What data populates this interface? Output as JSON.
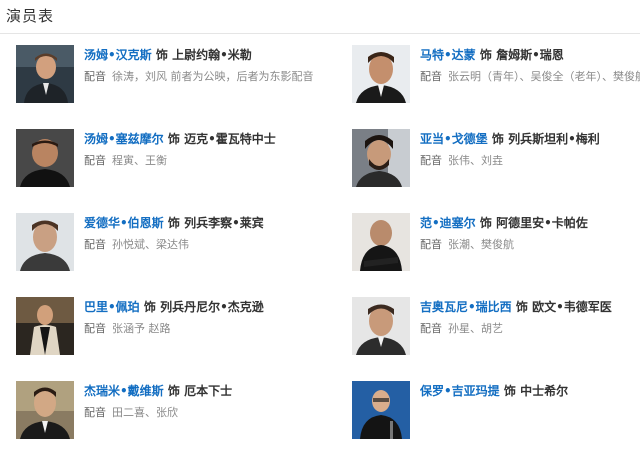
{
  "page": {
    "title": "演员表"
  },
  "cast": [
    {
      "actor": "汤姆•汉克斯",
      "connector": "饰",
      "role": "上尉约翰•米勒",
      "dub_label": "配音",
      "dubbers": "徐涛，刘风 前者为公映，后者为东影配音"
    },
    {
      "actor": "马特•达蒙",
      "connector": "饰",
      "role": "詹姆斯•瑞恩",
      "dub_label": "配音",
      "dubbers": "张云明（青年）、吴俊全（老年）、樊俊航"
    },
    {
      "actor": "汤姆•塞兹摩尔",
      "connector": "饰",
      "role": "迈克•霍瓦特中士",
      "dub_label": "配音",
      "dubbers": "程寅、王衡"
    },
    {
      "actor": "亚当•戈德堡",
      "connector": "饰",
      "role": "列兵斯坦利•梅利",
      "dub_label": "配音",
      "dubbers": "张伟、刘垚"
    },
    {
      "actor": "爱德华•伯恩斯",
      "connector": "饰",
      "role": "列兵李察•莱宾",
      "dub_label": "配音",
      "dubbers": "孙悦斌、梁达伟"
    },
    {
      "actor": "范•迪塞尔",
      "connector": "饰",
      "role": "阿德里安•卡帕佐",
      "dub_label": "配音",
      "dubbers": "张潮、樊俊航"
    },
    {
      "actor": "巴里•佩珀",
      "connector": "饰",
      "role": "列兵丹尼尔•杰克逊",
      "dub_label": "配音",
      "dubbers": "张涵予 赵路"
    },
    {
      "actor": "吉奥瓦尼•瑞比西",
      "connector": "饰",
      "role": "欧文•韦德军医",
      "dub_label": "配音",
      "dubbers": "孙星、胡艺"
    },
    {
      "actor": "杰瑞米•戴维斯",
      "connector": "饰",
      "role": "厄本下士",
      "dub_label": "配音",
      "dubbers": "田二喜、张欣"
    },
    {
      "actor": "保罗•吉亚玛提",
      "connector": "饰",
      "role": "中士希尔",
      "dub_label": "",
      "dubbers": ""
    }
  ]
}
